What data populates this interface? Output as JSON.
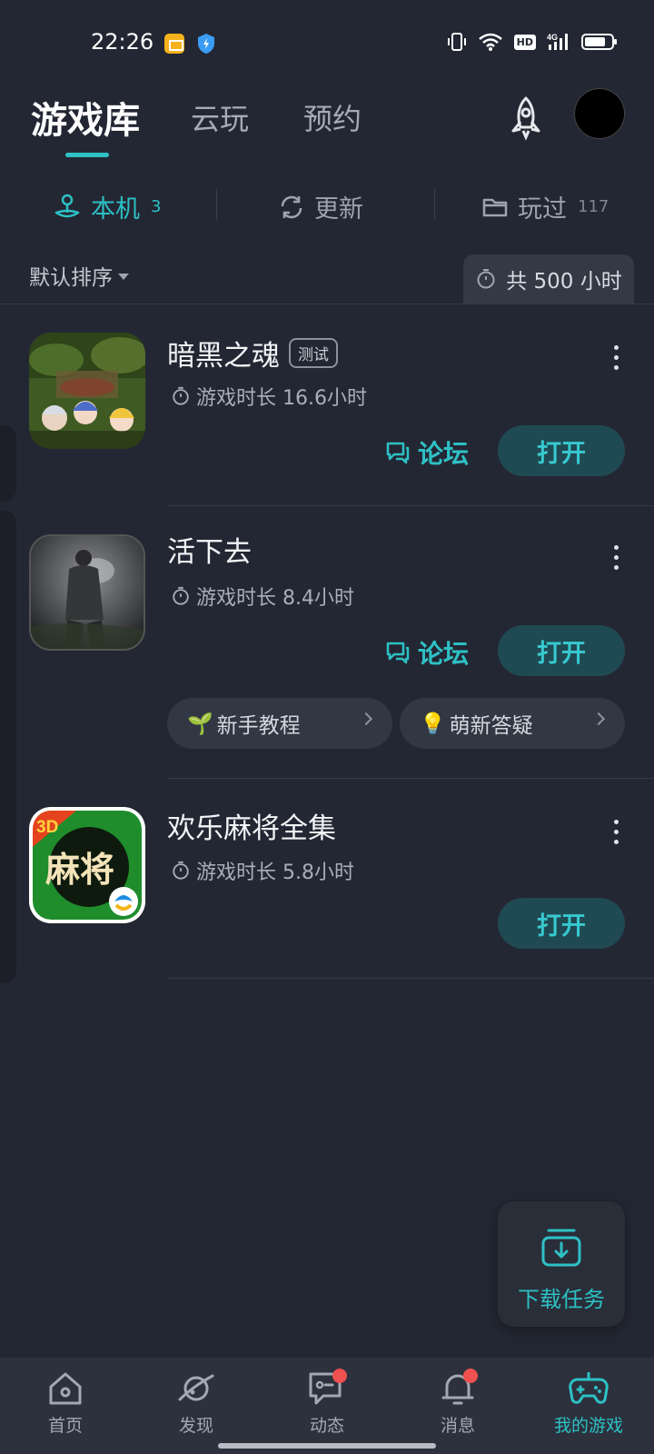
{
  "status_bar": {
    "time": "22:26",
    "network": "4G",
    "hd": "HD"
  },
  "top_tabs": [
    "游戏库",
    "云玩",
    "预约"
  ],
  "sub_tabs": [
    {
      "label": "本机",
      "count": "3"
    },
    {
      "label": "更新",
      "count": ""
    },
    {
      "label": "玩过",
      "count": "117"
    }
  ],
  "sort_label": "默认排序",
  "total_label": "共 500 小时",
  "games": [
    {
      "name": "暗黑之魂",
      "badge": "测试",
      "playtime": "游戏时长 16.6小时",
      "forum": "论坛",
      "open": "打开"
    },
    {
      "name": "活下去",
      "badge": "",
      "playtime": "游戏时长 8.4小时",
      "forum": "论坛",
      "open": "打开",
      "guides": [
        {
          "emoji": "🌱",
          "label": "新手教程"
        },
        {
          "emoji": "💡",
          "label": "萌新答疑"
        }
      ]
    },
    {
      "name": "欢乐麻将全集",
      "badge": "",
      "playtime": "游戏时长 5.8小时",
      "forum": "",
      "open": "打开",
      "icon_text": "麻将",
      "icon_tag": "3D"
    }
  ],
  "download_tasks": "下载任务",
  "bottom_nav": [
    {
      "label": "首页",
      "icon": "home-icon"
    },
    {
      "label": "发现",
      "icon": "planet-icon"
    },
    {
      "label": "动态",
      "icon": "chat-icon"
    },
    {
      "label": "消息",
      "icon": "bell-icon"
    },
    {
      "label": "我的游戏",
      "icon": "gamepad-icon"
    }
  ],
  "colors": {
    "accent": "#2dc1c5",
    "background": "#232733",
    "open_button": "#1f4a53",
    "badge_dot": "#ef5050"
  }
}
